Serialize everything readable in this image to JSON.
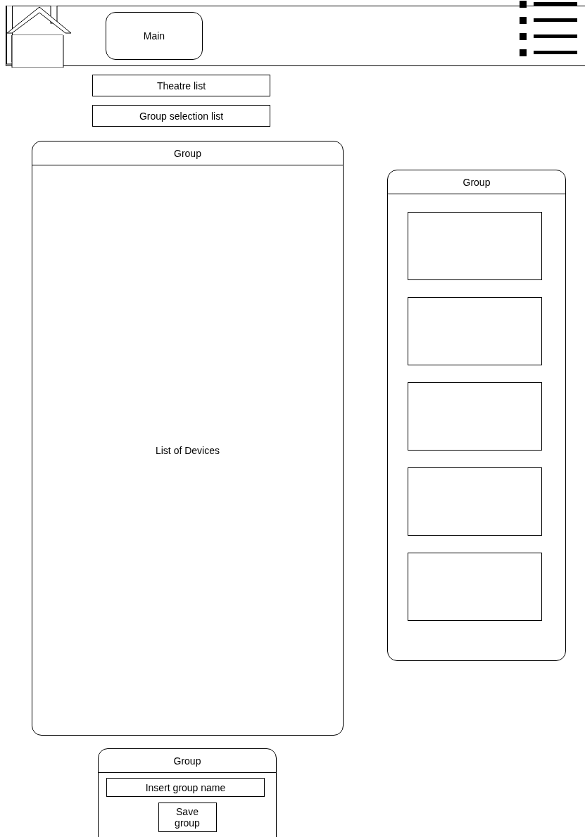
{
  "header": {
    "main_button": "Main"
  },
  "selectors": [
    {
      "label": "Theatre list"
    },
    {
      "label": "Group selection list"
    }
  ],
  "devices_panel": {
    "title": "Group",
    "content": "List of Devices"
  },
  "group_panel": {
    "title": "Group",
    "slots": [
      {
        "kind": "empty"
      },
      {
        "kind": "empty"
      },
      {
        "kind": "empty"
      },
      {
        "kind": "empty"
      },
      {
        "kind": "empty"
      }
    ]
  },
  "save_panel": {
    "title": "Group",
    "name_field": {
      "placeholder": "Insert group name"
    },
    "save_button": "Save group"
  }
}
